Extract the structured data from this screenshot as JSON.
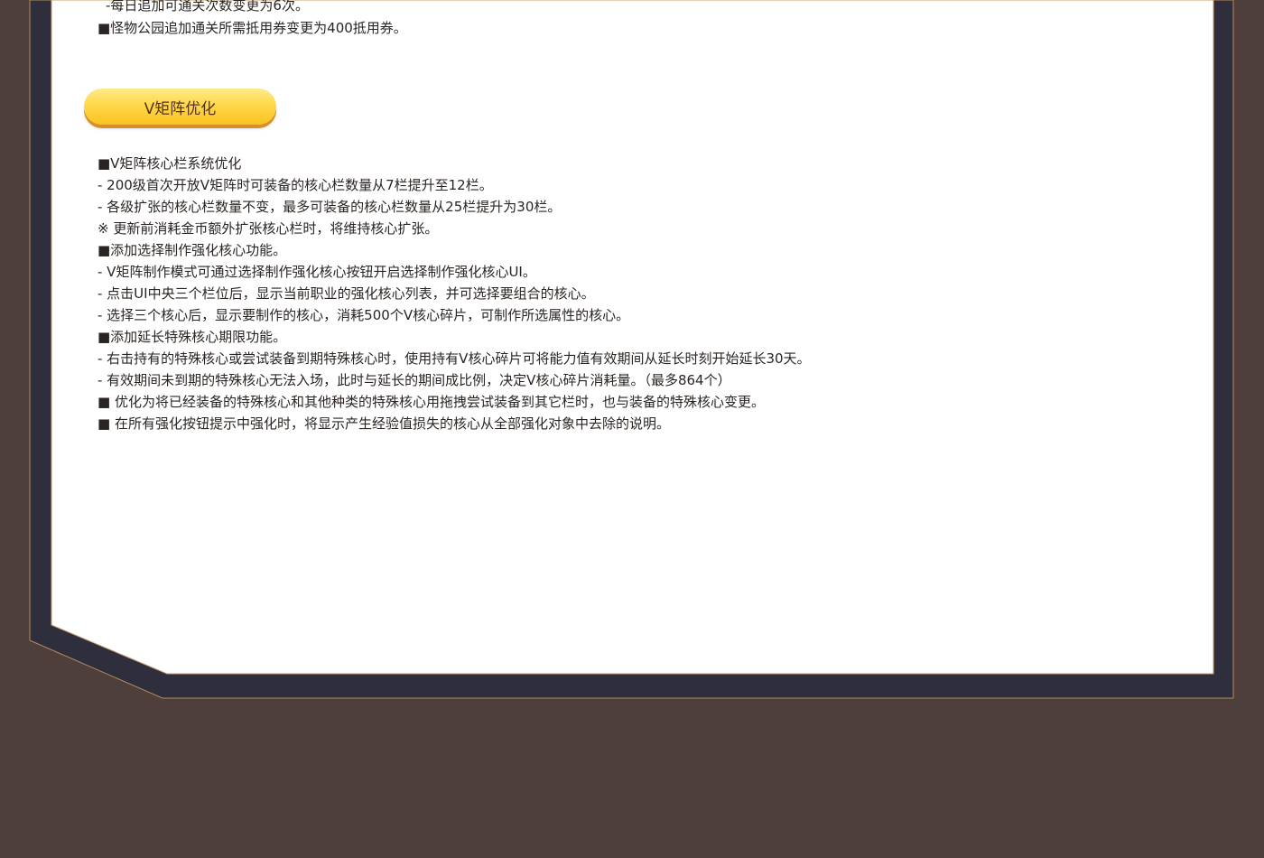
{
  "colors": {
    "page_background": "#4f3f3c",
    "frame_dark": "#2e2e3c",
    "frame_border": "#b58a5c",
    "panel_background": "#ffffff",
    "section_pill": "#ffd94a",
    "section_pill_text": "#55331f",
    "body_text": "#2a2522"
  },
  "previous_section": {
    "line1": "-每日追加可通关次数变更为6次。",
    "line2": "■怪物公园追加通关所需抵用券变更为400抵用券。"
  },
  "section": {
    "title": "V矩阵优化",
    "lines": [
      "■V矩阵核心栏系统优化",
      "- 200级首次开放V矩阵时可装备的核心栏数量从7栏提升至12栏。",
      "- 各级扩张的核心栏数量不变，最多可装备的核心栏数量从25栏提升为30栏。",
      "※ 更新前消耗金币额外扩张核心栏时，将维持核心扩张。",
      "■添加选择制作强化核心功能。",
      "- V矩阵制作模式可通过选择制作强化核心按钮开启选择制作强化核心UI。",
      "- 点击UI中央三个栏位后，显示当前职业的强化核心列表，并可选择要组合的核心。",
      "- 选择三个核心后，显示要制作的核心，消耗500个V核心碎片，可制作所选属性的核心。",
      "■添加延长特殊核心期限功能。",
      "- 右击持有的特殊核心或尝试装备到期特殊核心时，使用持有V核心碎片可将能力值有效期间从延长时刻开始延长30天。",
      "- 有效期间未到期的特殊核心无法入场，此时与延长的期间成比例，决定V核心碎片消耗量。（最多864个）",
      "■ 优化为将已经装备的特殊核心和其他种类的特殊核心用拖拽尝试装备到其它栏时，也与装备的特殊核心变更。",
      "■ 在所有强化按钮提示中强化时，将显示产生经验值损失的核心从全部强化对象中去除的说明。"
    ]
  }
}
